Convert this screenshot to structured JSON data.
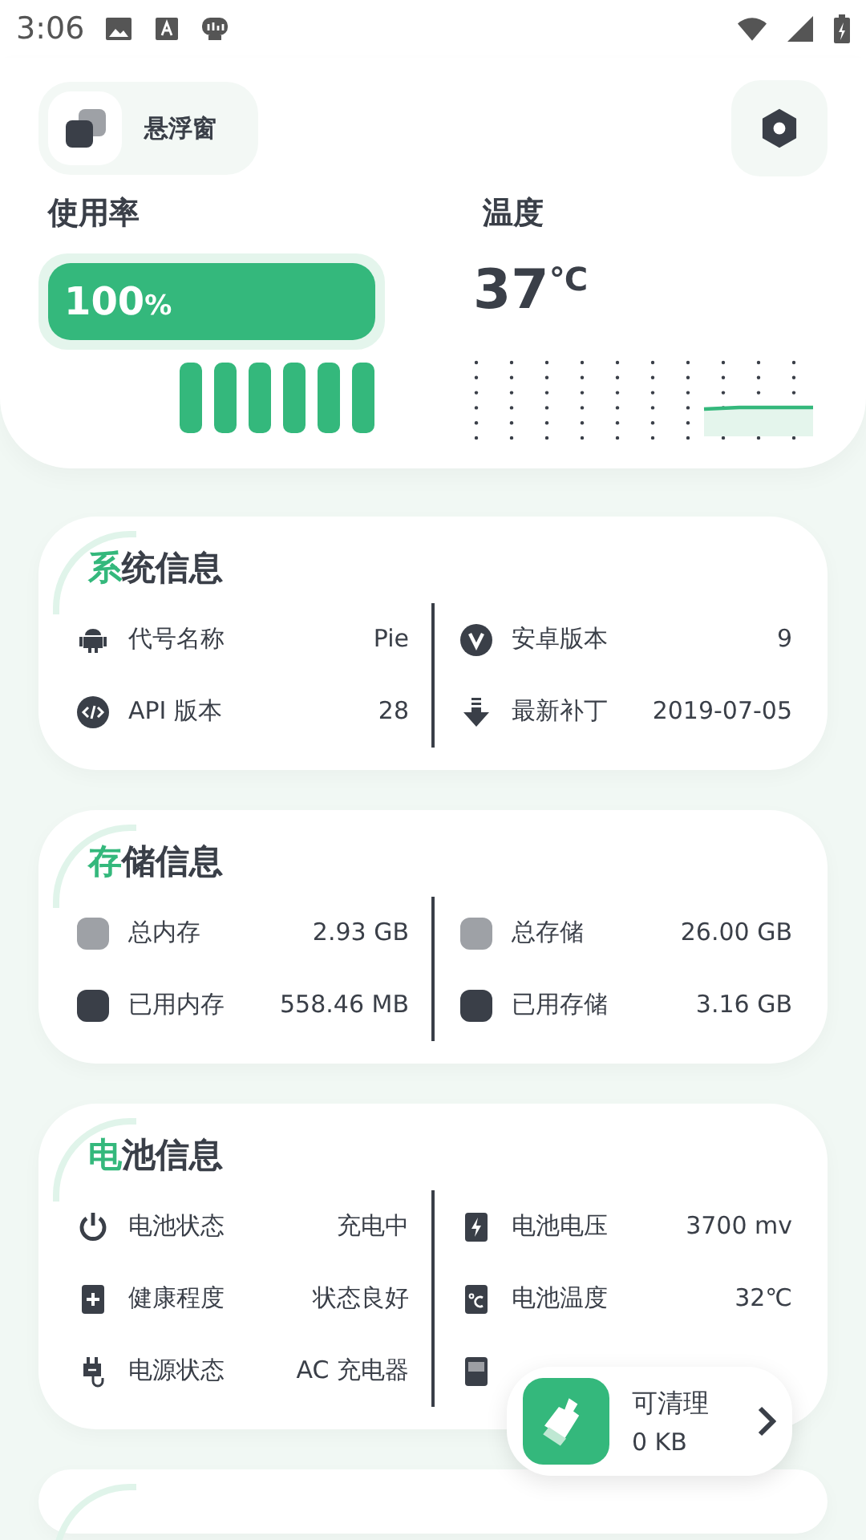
{
  "status_bar": {
    "time": "3:06"
  },
  "header": {
    "float_label": "悬浮窗"
  },
  "usage": {
    "title": "使用率",
    "value": "100",
    "unit": "%",
    "level": 1.0
  },
  "temperature": {
    "title": "温度",
    "value": "37",
    "unit": "℃"
  },
  "cards": [
    {
      "title": "系统信息",
      "left": [
        {
          "kind": "android",
          "label": "代号名称",
          "value": "Pie"
        },
        {
          "kind": "code",
          "label": "API 版本",
          "value": "28"
        }
      ],
      "right": [
        {
          "kind": "v",
          "label": "安卓版本",
          "value": "9"
        },
        {
          "kind": "download",
          "label": "最新补丁",
          "value": "2019-07-05"
        }
      ]
    },
    {
      "title": "存储信息",
      "left": [
        {
          "kind": "square",
          "color": "#9ea1a6",
          "label": "总内存",
          "value": "2.93 GB"
        },
        {
          "kind": "square",
          "color": "#3a3f48",
          "label": "已用内存",
          "value": "558.46 MB"
        }
      ],
      "right": [
        {
          "kind": "square",
          "color": "#9ea1a6",
          "label": "总存储",
          "value": "26.00 GB"
        },
        {
          "kind": "square",
          "color": "#3a3f48",
          "label": "已用存储",
          "value": "3.16 GB"
        }
      ]
    },
    {
      "title": "电池信息",
      "left": [
        {
          "kind": "power",
          "label": "电池状态",
          "value": "充电中"
        },
        {
          "kind": "plus",
          "label": "健康程度",
          "value": "状态良好"
        },
        {
          "kind": "plug",
          "label": "电源状态",
          "value": "AC 充电器"
        }
      ],
      "right": [
        {
          "kind": "bolt",
          "label": "电池电压",
          "value": "3700 mv"
        },
        {
          "kind": "celsius",
          "label": "电池温度",
          "value": "32℃"
        },
        {
          "kind": "blank"
        }
      ]
    }
  ],
  "clean": {
    "title": "可清理",
    "value": "0 KB"
  }
}
